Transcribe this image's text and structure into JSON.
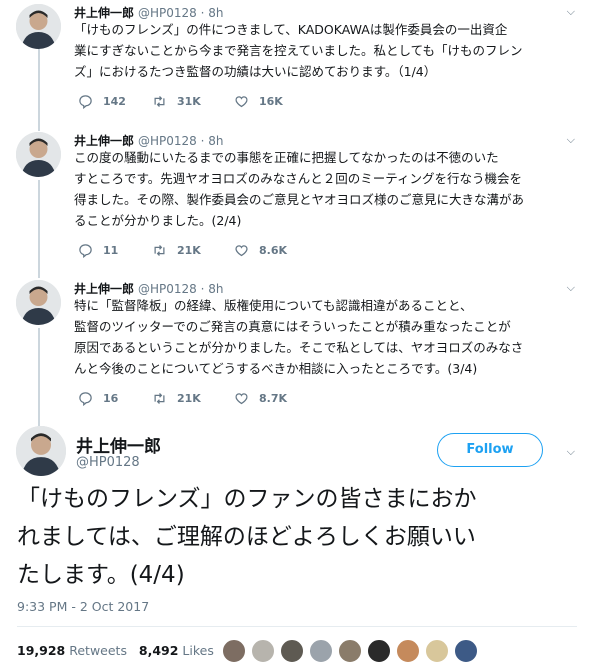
{
  "author": {
    "name": "井上伸一郎",
    "handle": "@HP0128"
  },
  "thread": [
    {
      "name": "井上伸一郎",
      "meta": "@HP0128 · 8h",
      "lines": [
        "「けものフレンズ」の件につきまして、KADOKAWAは製作委員会の一出資企",
        "業にすぎないことから今まで発言を控えていました。私としても「けものフレン",
        "ズ」におけるたつき監督の功績は大いに認めております。（1/4）"
      ],
      "replies": "142",
      "retweets": "31K",
      "likes": "16K"
    },
    {
      "name": "井上伸一郎",
      "meta": "@HP0128 · 8h",
      "lines": [
        "この度の騒動にいたるまでの事態を正確に把握してなかったのは不徳のいた",
        "すところです。先週ヤオヨロズのみなさんと２回のミーティングを行なう機会を",
        "得ました。その際、製作委員会のご意見とヤオヨロズ様のご意見に大きな溝があ",
        "ることが分かりました。(2/4)"
      ],
      "replies": "11",
      "retweets": "21K",
      "likes": "8.6K"
    },
    {
      "name": "井上伸一郎",
      "meta": "@HP0128 · 8h",
      "lines": [
        "特に「監督降板」の経緯、版権使用についても認識相違があることと、",
        "監督のツイッターでのご発言の真意にはそういったことが積み重なったことが",
        "原因であるということが分かりました。そこで私としては、ヤオヨロズのみなさ",
        "んと今後のことについてどうするべきか相談に入ったところです。(3/4)"
      ],
      "replies": "16",
      "retweets": "21K",
      "likes": "8.7K"
    }
  ],
  "main_tweet": {
    "follow_label": "Follow",
    "lines": [
      "「けものフレンズ」のファンの皆さまにおか",
      "れましては、ご理解のほどよろしくお願いい",
      "たします。(4/4)"
    ],
    "timestamp": "9:33 PM - 2 Oct 2017",
    "retweets_count": "19,928",
    "retweets_label": "Retweets",
    "likes_count": "8,492",
    "likes_label": "Likes"
  },
  "icons": {
    "reply": "reply-icon",
    "retweet": "retweet-icon",
    "like": "heart-icon",
    "caret": "chevron-down-icon"
  },
  "colors": {
    "accent": "#1da1f2",
    "muted": "#657786",
    "text": "#14171a",
    "thread_line": "#ccd6dd"
  }
}
